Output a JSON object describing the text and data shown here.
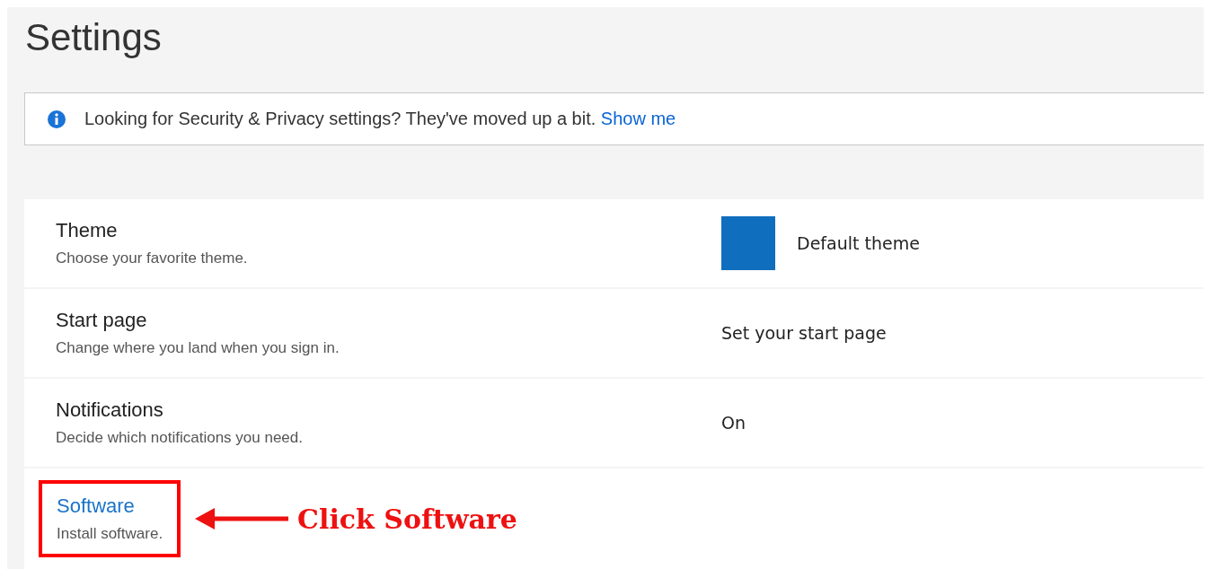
{
  "title": "Settings",
  "banner": {
    "text": "Looking for Security & Privacy settings? They've moved up a bit.",
    "link": "Show me"
  },
  "rows": [
    {
      "kind": "plain",
      "label": "Theme",
      "description": "Choose your favorite theme.",
      "value": "Default theme",
      "color": "#106ebe",
      "highlighted": false
    },
    {
      "kind": "plain",
      "label": "Start page",
      "description": "Change where you land when you sign in.",
      "value": "Set your start page",
      "highlighted": false
    },
    {
      "kind": "plain",
      "label": "Notifications",
      "description": "Decide which notifications you need.",
      "value": "On",
      "highlighted": false
    },
    {
      "kind": "link",
      "label": "Software",
      "description": "Install software.",
      "highlighted": true,
      "callout": "Click Software"
    }
  ]
}
